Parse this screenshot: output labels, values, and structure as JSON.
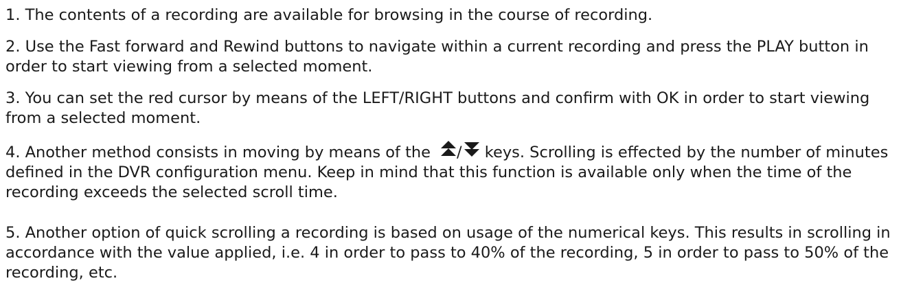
{
  "paragraphs": {
    "p1": "1. The contents of a recording are available for browsing in the course of recording.",
    "p2": "2. Use the Fast forward and Rewind buttons to navigate within a current recording and press the PLAY button in order to start viewing from a selected moment.",
    "p3": "3. You can set the red cursor by means of the LEFT/RIGHT buttons and confirm with OK in order to start viewing from a selected moment.",
    "p4": {
      "before": "4. Another method consists in moving by means of the",
      "separator": "/",
      "after": "keys. Scrolling is effected by the number of minutes defined in the DVR configuration menu. Keep in mind that this function is available only when the time of the recording exceeds the selected scroll time.",
      "icons": [
        "double-up-arrow-icon",
        "double-down-arrow-icon"
      ]
    },
    "p5": "5. Another option of quick scrolling a recording is based on usage of the numerical keys. This results in scrolling in accordance with the value applied, i.e. 4 in order to pass to 40% of the recording, 5 in order to pass to 50% of the recording, etc."
  },
  "colors": {
    "text": "#1a1a1a",
    "background": "#ffffff"
  }
}
